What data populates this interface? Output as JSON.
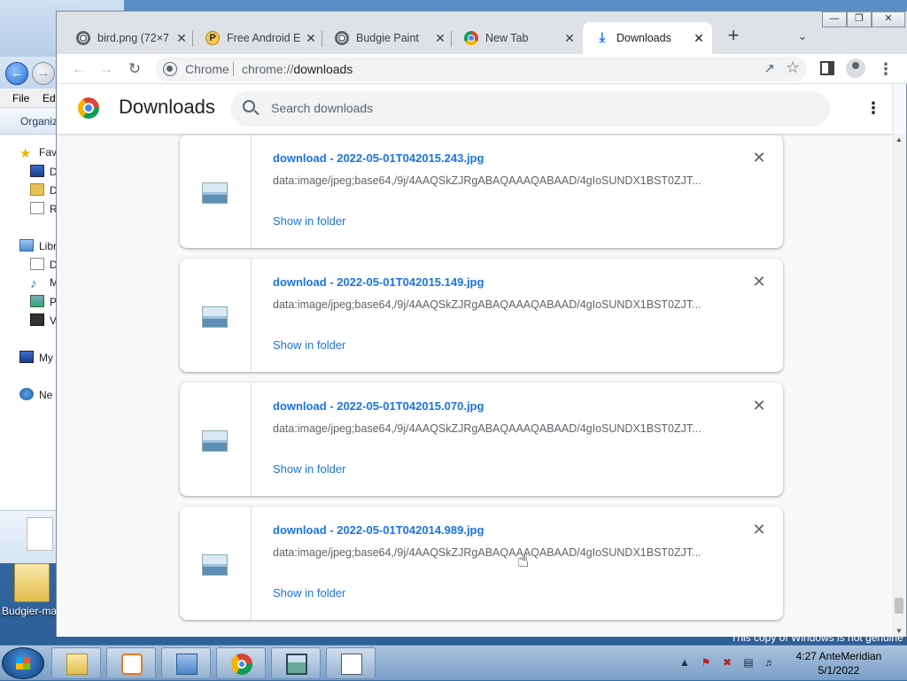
{
  "explorer": {
    "menu": [
      "File",
      "Ed"
    ],
    "command": "Organiz",
    "tree": [
      {
        "label": "Favo",
        "icon": "star-icon"
      },
      {
        "label": "D",
        "icon": "desktop-icon"
      },
      {
        "label": "D",
        "icon": "folder-icon"
      },
      {
        "label": "R",
        "icon": "recent-icon"
      },
      {
        "label": "Libr",
        "icon": "library-icon"
      },
      {
        "label": "D",
        "icon": "document-icon"
      },
      {
        "label": "M",
        "icon": "music-icon"
      },
      {
        "label": "P",
        "icon": "picture-icon"
      },
      {
        "label": "V",
        "icon": "video-icon"
      },
      {
        "label": "My",
        "icon": "computer-icon"
      },
      {
        "label": "Ne",
        "icon": "network-icon"
      }
    ]
  },
  "desktop": {
    "folder_label": "Budgier-ma"
  },
  "chrome": {
    "tabs": [
      {
        "label": "bird.png (72×7",
        "icon": "globe-icon"
      },
      {
        "label": "Free Android E",
        "icon": "p-badge-icon"
      },
      {
        "label": "Budgie Paint",
        "icon": "globe-icon"
      },
      {
        "label": "New Tab",
        "icon": "chrome-icon"
      },
      {
        "label": "Downloads",
        "icon": "download-icon",
        "active": true
      }
    ],
    "omnibox": {
      "scheme_label": "Chrome",
      "url_prefix": "chrome://",
      "url_host": "downloads"
    }
  },
  "page": {
    "title": "Downloads",
    "search_placeholder": "Search downloads",
    "downloads": [
      {
        "filename": "download - 2022-05-01T042015.243.jpg",
        "url": "data:image/jpeg;base64,/9j/4AAQSkZJRgABAQAAAQABAAD/4gIoSUNDX1BST0ZJT...",
        "action": "Show in folder"
      },
      {
        "filename": "download - 2022-05-01T042015.149.jpg",
        "url": "data:image/jpeg;base64,/9j/4AAQSkZJRgABAQAAAQABAAD/4gIoSUNDX1BST0ZJT...",
        "action": "Show in folder"
      },
      {
        "filename": "download - 2022-05-01T042015.070.jpg",
        "url": "data:image/jpeg;base64,/9j/4AAQSkZJRgABAQAAAQABAAD/4gIoSUNDX1BST0ZJT...",
        "action": "Show in folder"
      },
      {
        "filename": "download - 2022-05-01T042014.989.jpg",
        "url": "data:image/jpeg;base64,/9j/4AAQSkZJRgABAQAAAQABAAD/4gIoSUNDX1BST0ZJT...",
        "action": "Show in folder"
      }
    ]
  },
  "taskbar": {
    "apps": [
      "file-explorer",
      "media-player",
      "control-panel",
      "chrome",
      "photo-viewer",
      "notepad"
    ],
    "clock_time": "4:27 AnteMeridian",
    "clock_date": "5/1/2022",
    "watermark": "This copy of Windows is not genuine"
  }
}
